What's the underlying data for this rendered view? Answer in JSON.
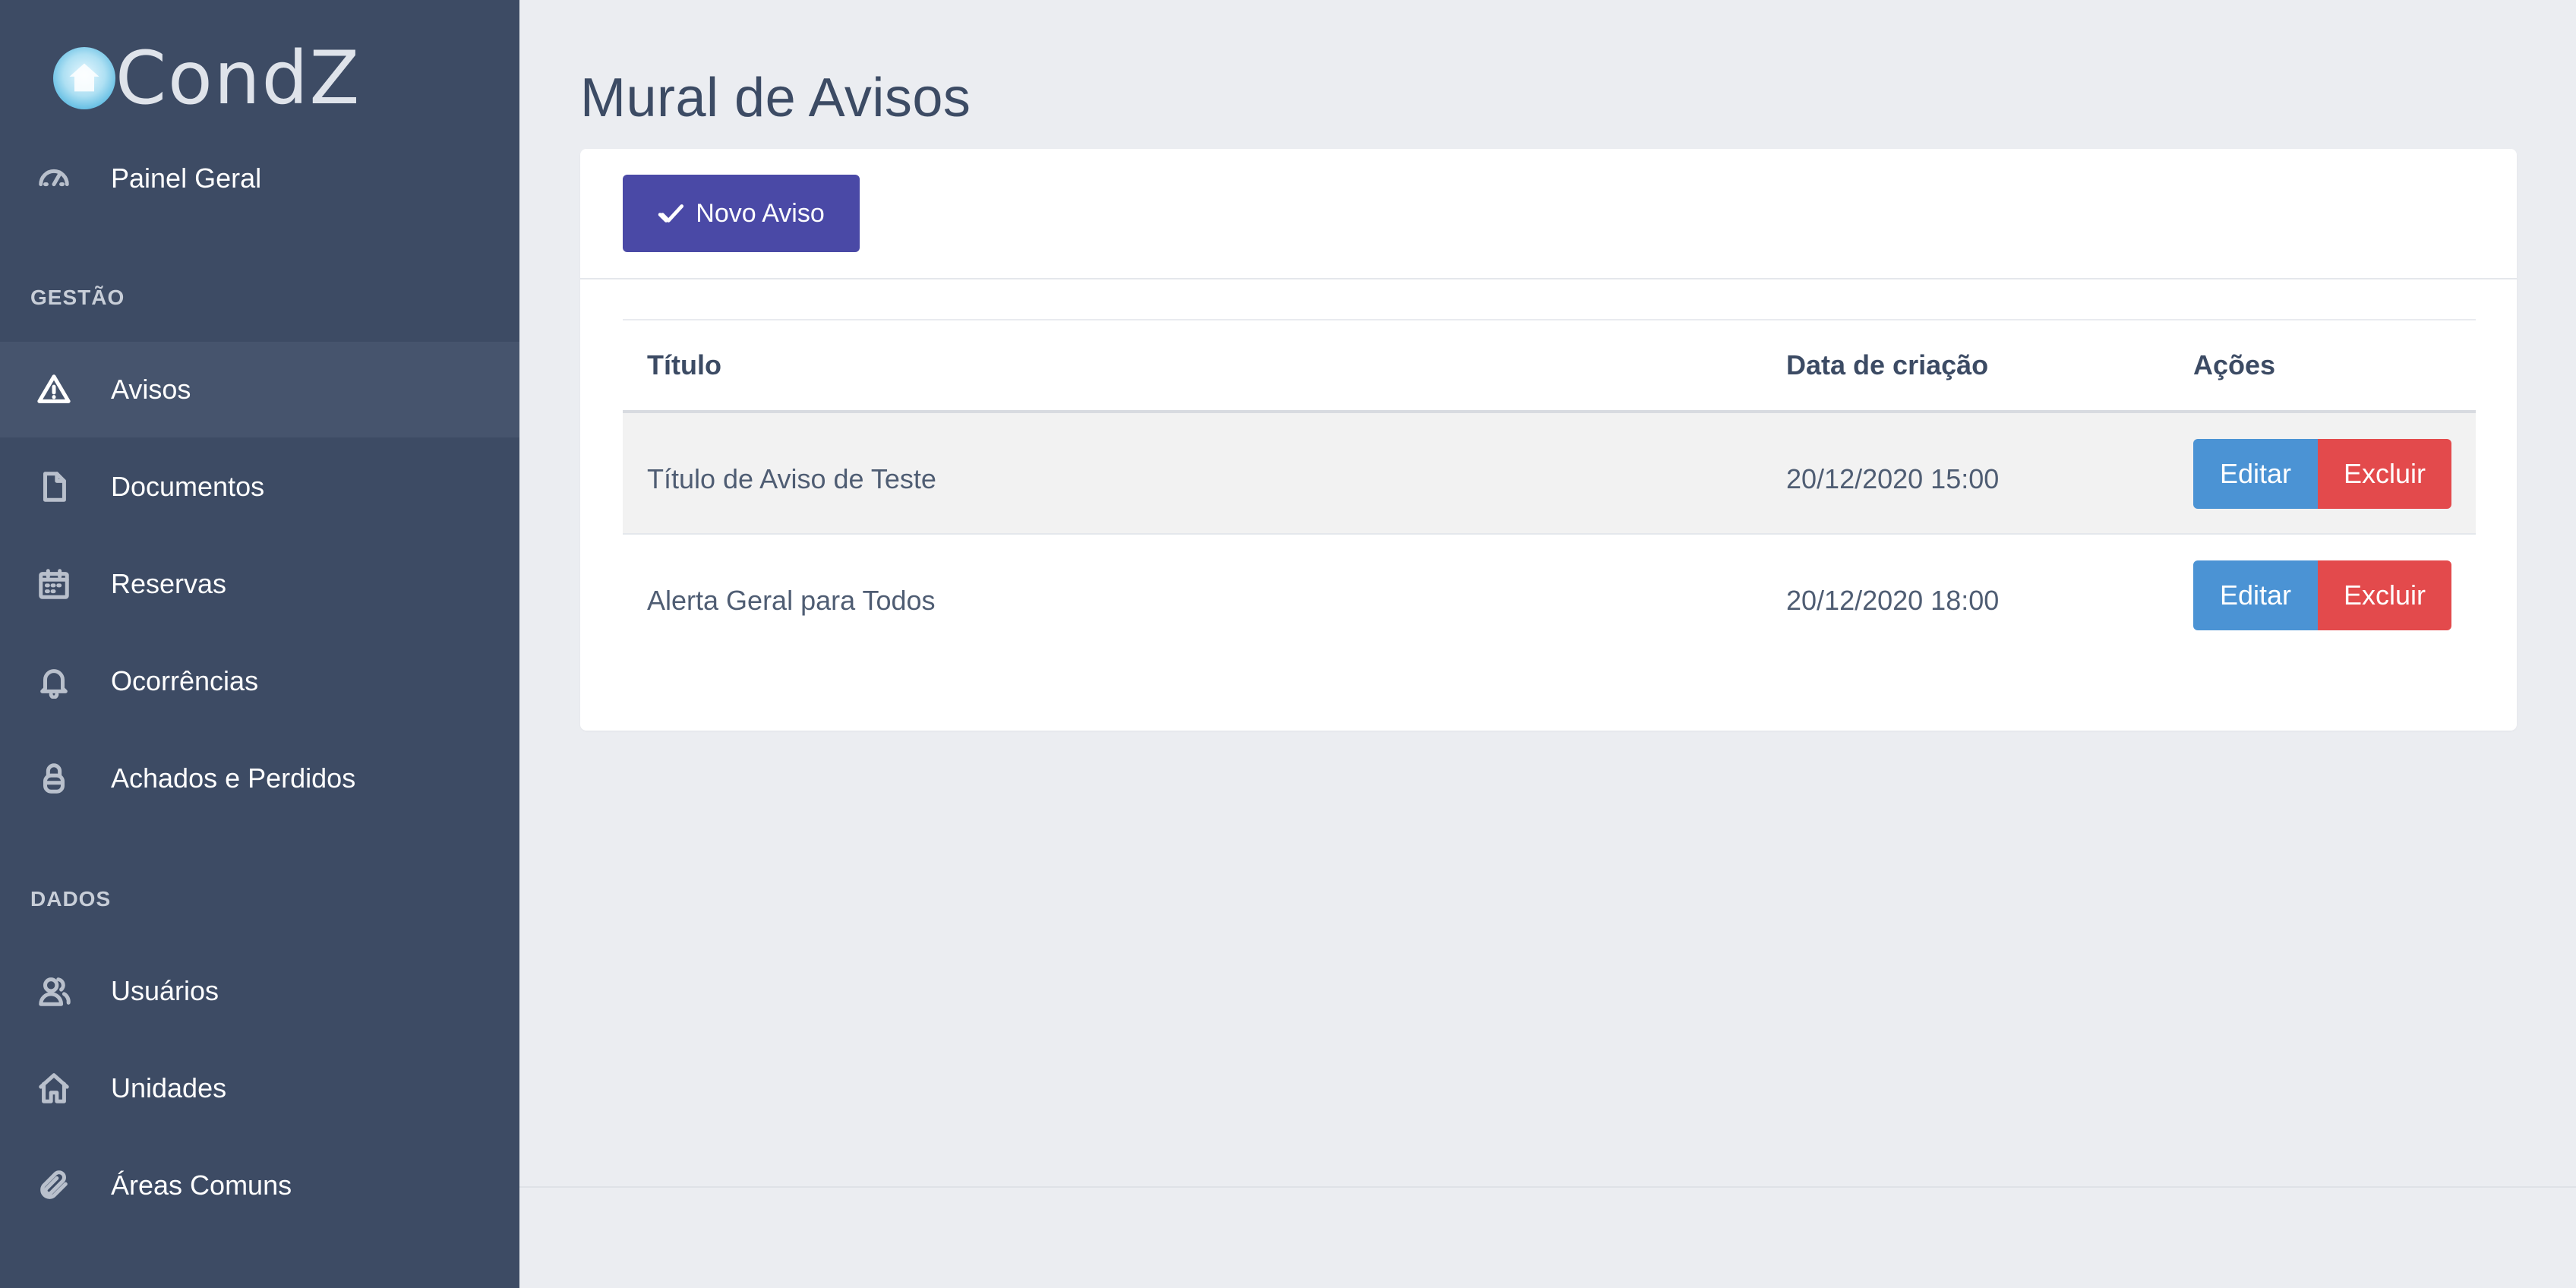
{
  "brand": {
    "name": "CondZ"
  },
  "sidebar": {
    "painel": "Painel Geral",
    "section_gestao": "GESTÃO",
    "section_dados": "DADOS",
    "items": [
      {
        "label": "Avisos",
        "icon": "warning-icon"
      },
      {
        "label": "Documentos",
        "icon": "document-icon"
      },
      {
        "label": "Reservas",
        "icon": "calendar-icon"
      },
      {
        "label": "Ocorrências",
        "icon": "bell-icon"
      },
      {
        "label": "Achados e Perdidos",
        "icon": "lock-icon"
      },
      {
        "label": "Usuários",
        "icon": "users-icon"
      },
      {
        "label": "Unidades",
        "icon": "home-icon"
      },
      {
        "label": "Áreas Comuns",
        "icon": "paperclip-icon"
      }
    ]
  },
  "page": {
    "title": "Mural de Avisos"
  },
  "toolbar": {
    "new_label": "Novo Aviso"
  },
  "table": {
    "headers": {
      "title": "Título",
      "date": "Data de criação",
      "actions": "Ações"
    },
    "rows": [
      {
        "title": "Título de Aviso de Teste",
        "date": "20/12/2020 15:00"
      },
      {
        "title": "Alerta Geral para Todos",
        "date": "20/12/2020 18:00"
      }
    ],
    "edit_label": "Editar",
    "delete_label": "Excluir"
  },
  "colors": {
    "sidebar": "#3d4b64",
    "primary": "#4a49a6",
    "edit": "#4b93d4",
    "delete": "#e34a4c"
  }
}
